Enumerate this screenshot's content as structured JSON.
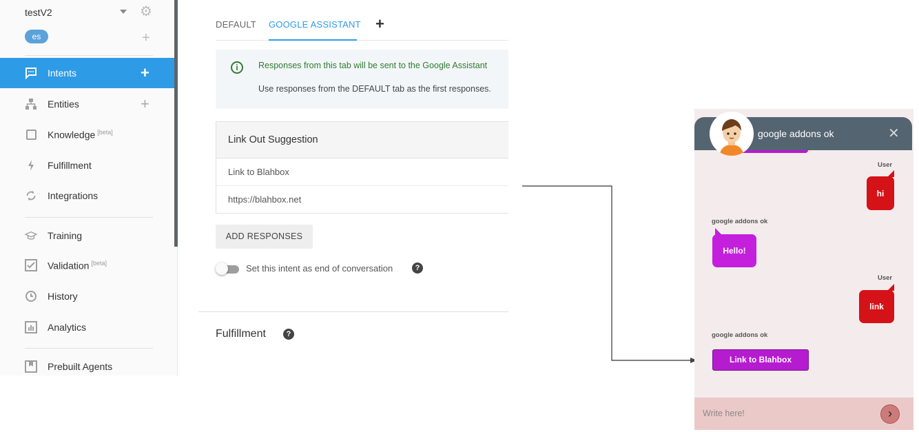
{
  "sidebar": {
    "agent_name": "testV2",
    "language": "es",
    "items": [
      {
        "label": "Intents",
        "icon": "chat-bubble-icon",
        "active": true,
        "has_plus": true
      },
      {
        "label": "Entities",
        "icon": "sitemap-icon",
        "has_plus": true
      },
      {
        "label": "Knowledge",
        "badge": "[beta]",
        "icon": "book-icon"
      },
      {
        "label": "Fulfillment",
        "icon": "bolt-icon"
      },
      {
        "label": "Integrations",
        "icon": "sync-icon"
      },
      {
        "label": "Training",
        "icon": "graduation-cap-icon"
      },
      {
        "label": "Validation",
        "badge": "[beta]",
        "icon": "check-box-icon"
      },
      {
        "label": "History",
        "icon": "clock-icon"
      },
      {
        "label": "Analytics",
        "icon": "bar-chart-icon"
      },
      {
        "label": "Prebuilt Agents",
        "icon": "bookmark-icon"
      }
    ]
  },
  "tabs": [
    {
      "label": "DEFAULT",
      "active": false
    },
    {
      "label": "GOOGLE ASSISTANT",
      "active": true
    }
  ],
  "notice": {
    "line1": "Responses from this tab will be sent to the Google Assistant",
    "line2": "Use responses from the DEFAULT tab as the first responses."
  },
  "card": {
    "title": "Link Out Suggestion",
    "link_name": "Link to Blahbox",
    "link_url": "https://blahbox.net"
  },
  "add_responses_label": "ADD RESPONSES",
  "end_conversation": {
    "label": "Set this intent as end of conversation",
    "enabled": false
  },
  "fulfillment_heading": "Fulfillment",
  "chat": {
    "title": "google addons ok",
    "messages": [
      {
        "from": "User",
        "text": "hi"
      },
      {
        "from": "google addons ok",
        "text": "Hello!"
      },
      {
        "from": "User",
        "text": "link"
      },
      {
        "from": "google addons ok",
        "text": "Link to Blahbox",
        "type": "link-button"
      }
    ],
    "input_placeholder": "Write here!"
  },
  "colors": {
    "accent": "#2e9be6",
    "notice_green": "#2e7d32",
    "user_bubble": "#d41218",
    "bot_bubble": "#c31fdc",
    "chat_header": "#546470"
  }
}
